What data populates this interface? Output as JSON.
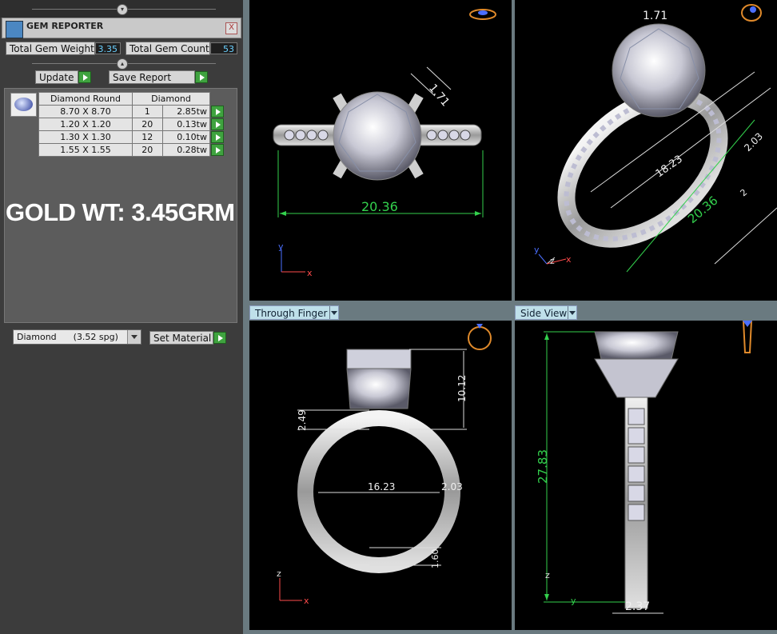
{
  "panel": {
    "title": "GEM REPORTER",
    "close_glyph": "X",
    "total_weight_label": "Total Gem Weight",
    "total_weight_value": "3.35",
    "total_count_label": "Total Gem Count",
    "total_count_value": "53",
    "update_label": "Update",
    "save_report_label": "Save Report",
    "table": {
      "headers": [
        "Diamond Round",
        "Diamond"
      ],
      "rows": [
        {
          "size": "8.70 X 8.70",
          "count": "1",
          "weight": "2.85tw"
        },
        {
          "size": "1.20 X 1.20",
          "count": "20",
          "weight": "0.13tw"
        },
        {
          "size": "1.30 X 1.30",
          "count": "12",
          "weight": "0.10tw"
        },
        {
          "size": "1.55 X 1.55",
          "count": "20",
          "weight": "0.28tw"
        }
      ]
    },
    "gold_weight": "GOLD WT: 3.45GRM",
    "material_select": "Diamond      (3.52 spg)",
    "set_material_label": "Set Material"
  },
  "viewports": {
    "top": {
      "dims": [
        "1.71",
        "20.36"
      ],
      "axes": [
        "y",
        "x"
      ]
    },
    "perspective": {
      "dims": [
        "1.71",
        "18.23",
        "2.03",
        "20.36",
        "2"
      ],
      "axes": [
        "y",
        "z",
        "x"
      ]
    },
    "through_finger": {
      "label": "Through Finger",
      "dims": [
        "10.12",
        "2.49",
        "16.23",
        "2.03",
        "1.60"
      ],
      "axes": [
        "z",
        "x"
      ]
    },
    "side_view": {
      "label": "Side View",
      "dims": [
        "27.83",
        "2.37"
      ],
      "axes": [
        "z",
        "y"
      ]
    }
  },
  "colors": {
    "dimension": "#33d14d",
    "viewport_bg": "#000000",
    "panel_bg": "#3c3c3c",
    "label_bg": "#bfe0ea"
  }
}
